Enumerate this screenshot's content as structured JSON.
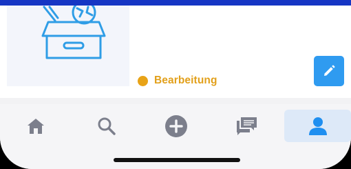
{
  "item": {
    "image_icon": "toy-box-illustration",
    "status_label": "Bearbeitung",
    "status_color": "#e8a317",
    "edit_icon": "pencil-icon"
  },
  "tabbar": {
    "tabs": [
      {
        "icon": "home-icon",
        "active": false
      },
      {
        "icon": "search-icon",
        "active": false
      },
      {
        "icon": "add-circle-icon",
        "active": false
      },
      {
        "icon": "messages-icon",
        "active": false
      },
      {
        "icon": "profile-icon",
        "active": true
      }
    ],
    "active_color": "#1f8ff0",
    "inactive_color": "#7c7f8c"
  }
}
